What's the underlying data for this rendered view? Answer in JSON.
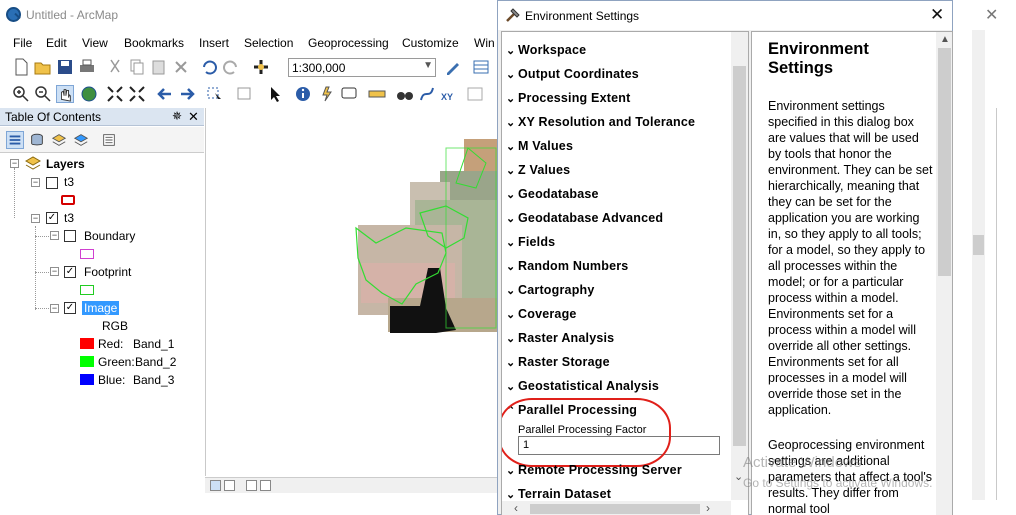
{
  "app": {
    "title": "Untitled - ArcMap",
    "menu": [
      "File",
      "Edit",
      "View",
      "Bookmarks",
      "Insert",
      "Selection",
      "Geoprocessing",
      "Customize",
      "Win"
    ],
    "scale": "1:300,000"
  },
  "toc": {
    "title": "Table Of Contents",
    "pin": "✵",
    "close": "✕",
    "root": "Layers",
    "layers": [
      {
        "name": "t3",
        "checked": false
      },
      {
        "name": "t3",
        "checked": true
      }
    ],
    "sublayers": {
      "boundary": "Boundary",
      "footprint": "Footprint",
      "image": "Image",
      "rgb": "RGB",
      "red": "Red:",
      "red_band": "Band_1",
      "green": "Green:",
      "green_band": "Band_2",
      "blue": "Blue:",
      "blue_band": "Band_3"
    }
  },
  "dialog": {
    "title": "Environment Settings",
    "close": "✕",
    "sections": [
      "Workspace",
      "Output Coordinates",
      "Processing Extent",
      "XY Resolution and Tolerance",
      "M Values",
      "Z Values",
      "Geodatabase",
      "Geodatabase Advanced",
      "Fields",
      "Random Numbers",
      "Cartography",
      "Coverage",
      "Raster Analysis",
      "Raster Storage",
      "Geostatistical Analysis",
      "Parallel Processing",
      "Remote Processing Server",
      "Terrain Dataset"
    ],
    "parallel": {
      "label": "Parallel Processing Factor",
      "value": "1"
    },
    "help": {
      "title": "Environment Settings",
      "para1": "Environment settings specified in this dialog box are values that will be used by tools that honor the environment. They can be set hierarchically, meaning that they can be set for the application you are working in, so they apply to all tools; for a model, so they apply to all processes within the model; or for a particular process within a model. Environments set for a process within a model will override all other settings. Environments set for all processes in a model will override those set in the application.",
      "para2": "Geoprocessing environment settings are additional parameters that affect a tool's results. They differ from normal tool"
    }
  },
  "watermark": {
    "line1": "Activate Windows",
    "line2": "Go to Settings to activate Windows."
  },
  "colors": {
    "highlight": "#e0201a",
    "selection": "#3399ff",
    "band_red": "#ff0000",
    "band_green": "#00ff00",
    "band_blue": "#0000ff"
  }
}
